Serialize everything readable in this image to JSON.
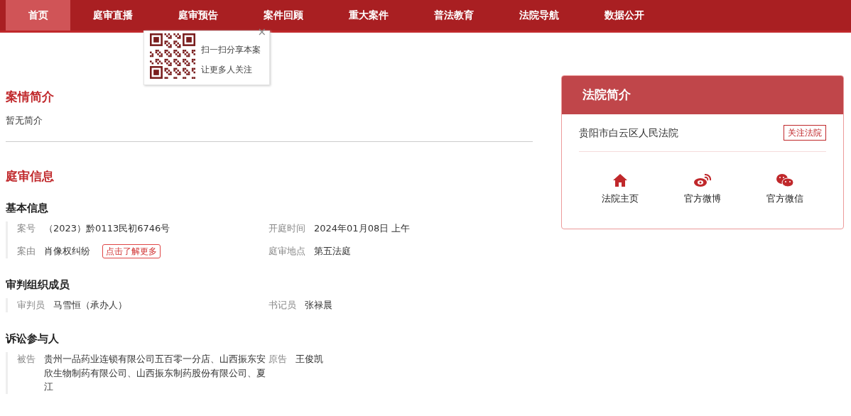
{
  "nav": [
    {
      "label": "首页",
      "selected": true
    },
    {
      "label": "庭审直播",
      "selected": false
    },
    {
      "label": "庭审预告",
      "selected": false
    },
    {
      "label": "案件回顾",
      "selected": false
    },
    {
      "label": "重大案件",
      "selected": false
    },
    {
      "label": "普法教育",
      "selected": false
    },
    {
      "label": "法院导航",
      "selected": false
    },
    {
      "label": "数据公开",
      "selected": false
    }
  ],
  "share_popup": {
    "close": "×",
    "lines": [
      "扫一扫分享本案",
      "让更多人关注"
    ]
  },
  "case_summary": {
    "title": "案情简介",
    "text": "暂无简介"
  },
  "trial_info": {
    "title": "庭审信息",
    "groups": [
      {
        "title": "基本信息",
        "rows": [
          [
            {
              "label": "案号",
              "value": "（2023）黔0113民初6746号"
            },
            {
              "label": "开庭时间",
              "value": "2024年01月08日 上午"
            }
          ],
          [
            {
              "label": "案由",
              "value": "肖像权纠纷",
              "tag": "点击了解更多"
            },
            {
              "label": "庭审地点",
              "value": "第五法庭"
            }
          ]
        ]
      },
      {
        "title": "审判组织成员",
        "rows": [
          [
            {
              "label": "审判员",
              "value": "马雪恒（承办人）"
            },
            {
              "label": "书记员",
              "value": "张禄晨"
            }
          ]
        ]
      },
      {
        "title": "诉讼参与人",
        "rows": [
          [
            {
              "label": "被告",
              "value": "贵州一品药业连锁有限公司五百零一分店、山西振东安欣生物制药有限公司、山西振东制药股份有限公司、夏江"
            },
            {
              "label": "原告",
              "value": "王俊凯"
            }
          ]
        ]
      }
    ]
  },
  "court": {
    "title": "法院简介",
    "name": "贵阳市白云区人民法院",
    "follow_button": "关注法院",
    "links": [
      {
        "kind": "home",
        "label": "法院主页"
      },
      {
        "kind": "weibo",
        "label": "官方微博"
      },
      {
        "kind": "wechat",
        "label": "官方微信"
      }
    ]
  }
}
